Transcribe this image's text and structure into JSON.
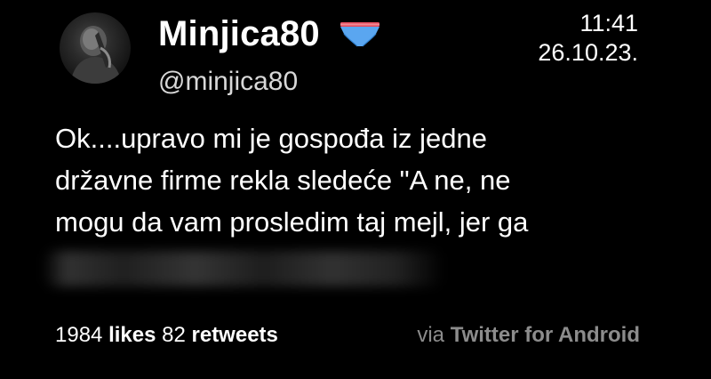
{
  "tweet": {
    "author": {
      "display_name": "Minjica80",
      "handle": "@minjica80",
      "name_icon": "underwear-icon"
    },
    "time": "11:41",
    "date": "26.10.23.",
    "text_lines": [
      "Ok....upravo mi je gospođa iz jedne",
      "državne firme rekla sledeće \"A ne, ne",
      "mogu da vam prosledim taj mejl, jer ga"
    ],
    "stats": {
      "likes_count": "1984",
      "likes_label": "likes",
      "retweets_count": "82",
      "retweets_label": "retweets"
    },
    "source": {
      "prefix": "via",
      "app": "Twitter for Android"
    }
  },
  "colors": {
    "background": "#000000",
    "text": "#ffffff",
    "muted": "#8c8c8c",
    "icon_blue": "#5aa6f0"
  }
}
